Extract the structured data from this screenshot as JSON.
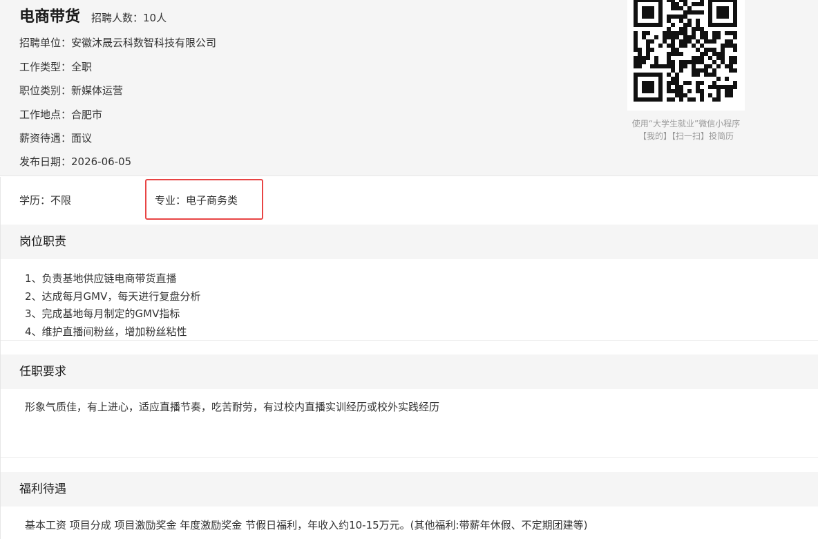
{
  "job": {
    "title": "电商带货",
    "headcount": "招聘人数：10人",
    "company": "招聘单位：安徽沐晟云科数智科技有限公司",
    "work_type": "工作类型：全职",
    "category": "职位类别：新媒体运营",
    "location": "工作地点：合肥市",
    "salary": "薪资待遇：面议",
    "publish_date": "发布日期：2026-06-05"
  },
  "qr": {
    "caption_line1": "使用“大学生就业”微信小程序",
    "caption_line2": "【我的】【扫一扫】投简历",
    "icon": "qr-code-icon"
  },
  "meta": {
    "education": "学历：不限",
    "major": "专业：电子商务类",
    "highlight_color": "#e84444"
  },
  "sections": {
    "duties": {
      "heading": "岗位职责",
      "lines": [
        "1、负责基地供应链电商带货直播",
        "2、达成每月GMV，每天进行复盘分析",
        "3、完成基地每月制定的GMV指标",
        "4、维护直播间粉丝，增加粉丝粘性"
      ]
    },
    "requirements": {
      "heading": "任职要求",
      "text": "形象气质佳，有上进心，适应直播节奏，吃苦耐劳，有过校内直播实训经历或校外实践经历"
    },
    "benefits": {
      "heading": "福利待遇",
      "text": "基本工资 项目分成 项目激励奖金 年度激励奖金 节假日福利，年收入约10-15万元。(其他福利:带薪年休假、不定期团建等)"
    }
  }
}
